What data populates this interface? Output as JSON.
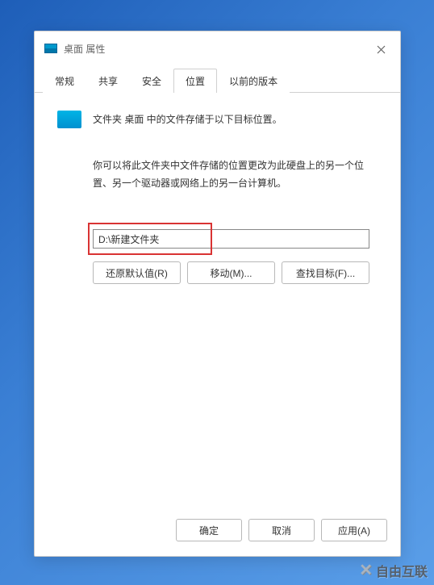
{
  "window": {
    "title": "桌面 属性"
  },
  "tabs": [
    {
      "label": "常规"
    },
    {
      "label": "共享"
    },
    {
      "label": "安全"
    },
    {
      "label": "位置",
      "active": true
    },
    {
      "label": "以前的版本"
    }
  ],
  "content": {
    "header_text": "文件夹 桌面 中的文件存储于以下目标位置。",
    "description": "你可以将此文件夹中文件存储的位置更改为此硬盘上的另一个位置、另一个驱动器或网络上的另一台计算机。",
    "path_value": "D:\\新建文件夹"
  },
  "buttons": {
    "restore": "还原默认值(R)",
    "move": "移动(M)...",
    "find": "查找目标(F)..."
  },
  "footer": {
    "ok": "确定",
    "cancel": "取消",
    "apply": "应用(A)"
  },
  "watermark": {
    "text": "自由互联"
  }
}
